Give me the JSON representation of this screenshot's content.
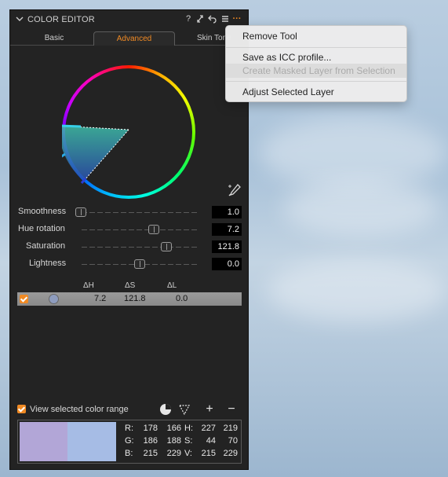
{
  "panel": {
    "title": "COLOR EDITOR",
    "header_icons": [
      "help-icon",
      "expand-icon",
      "reset-icon",
      "list-icon",
      "more-icon"
    ],
    "accent": "#f08a24"
  },
  "tabs": [
    "Basic",
    "Advanced",
    "Skin Tone"
  ],
  "active_tab": "Advanced",
  "sliders": [
    {
      "label": "Smoothness",
      "value": "1.0",
      "level": 0.0
    },
    {
      "label": "Hue rotation",
      "value": "7.2",
      "level": 0.62
    },
    {
      "label": "Saturation",
      "value": "121.8",
      "level": 0.72
    },
    {
      "label": "Lightness",
      "value": "0.0",
      "level": 0.5
    }
  ],
  "table": {
    "headers": [
      "ΔH",
      "ΔS",
      "ΔL"
    ],
    "row": {
      "checked": true,
      "dh": "7.2",
      "ds": "121.8",
      "dl": "0.0"
    }
  },
  "view_selected_label": "View selected color range",
  "readout": {
    "r_label": "R:",
    "r1": "178",
    "r2": "166",
    "g_label": "G:",
    "g1": "186",
    "g2": "188",
    "b_label": "B:",
    "b1": "215",
    "b2": "229",
    "h_label": "H:",
    "h1": "227",
    "h2": "219",
    "s_label": "S:",
    "s1": "44",
    "s2": "70",
    "v_label": "V:",
    "v1": "215",
    "v2": "229",
    "swatch_colors": [
      "#b2a6d7",
      "#a6bce5"
    ]
  },
  "context_menu": {
    "items": [
      "Remove Tool",
      "Save as ICC profile...",
      "Create Masked Layer from Selection",
      "Adjust Selected Layer"
    ],
    "disabled_index": 2
  }
}
